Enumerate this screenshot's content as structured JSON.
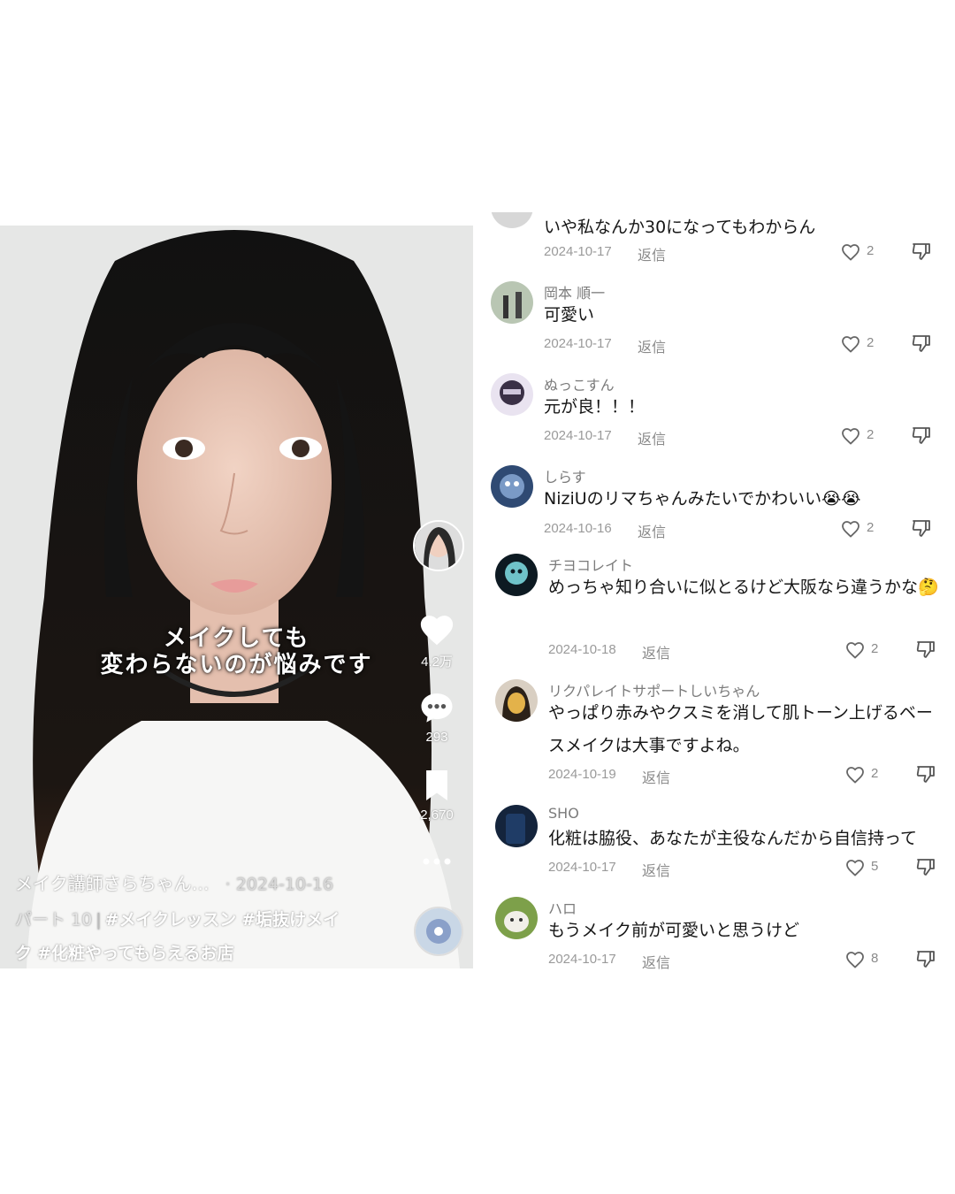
{
  "video": {
    "caption_line1": "メイクしても",
    "caption_line2": "変わらないのが悩みです",
    "likes": "4.2万",
    "comments": "293",
    "saves": "2,670",
    "creator_name": "メイク講師さらちゃん…",
    "post_date": "· 2024-10-16",
    "part_label": "パート 10",
    "tag1": "#メイクレッスン",
    "tag2": "#垢抜けメイク",
    "tag3": "#化粧やってもらえるお店",
    "icons": [
      "heart-icon",
      "comment-icon",
      "bookmark-icon",
      "more-icon"
    ]
  },
  "comments": {
    "partial_text": "いや私なんか30になってもわからん",
    "reply_label": "返信",
    "items": [
      {
        "name": "",
        "text": "",
        "date": "2024-10-17",
        "likes": "2"
      },
      {
        "name": "岡本 順一",
        "text": "可愛い",
        "date": "2024-10-17",
        "likes": "2"
      },
      {
        "name": "ぬっこすん",
        "text": "元が良！！！",
        "date": "2024-10-17",
        "likes": "2"
      },
      {
        "name": "しらす",
        "text": "NiziUのリマちゃんみたいでかわいい😭😭",
        "date": "2024-10-16",
        "likes": "2"
      },
      {
        "name": "チヨコレイト",
        "text": "めっちゃ知り合いに似とるけど大阪なら違うかな🤔",
        "date": "2024-10-18",
        "likes": "2"
      },
      {
        "name": "リクパレイトサポートしいちゃん",
        "text": "やっぱり赤みやクスミを消して肌トーン上げるベースメイクは大事ですよね。",
        "date": "2024-10-19",
        "likes": "2"
      },
      {
        "name": "SHO",
        "text": "化粧は脇役、あなたが主役なんだから自信持って",
        "date": "2024-10-17",
        "likes": "5"
      },
      {
        "name": "ハロ",
        "text": "もうメイク前が可愛いと思うけど",
        "date": "2024-10-17",
        "likes": "8"
      }
    ]
  }
}
